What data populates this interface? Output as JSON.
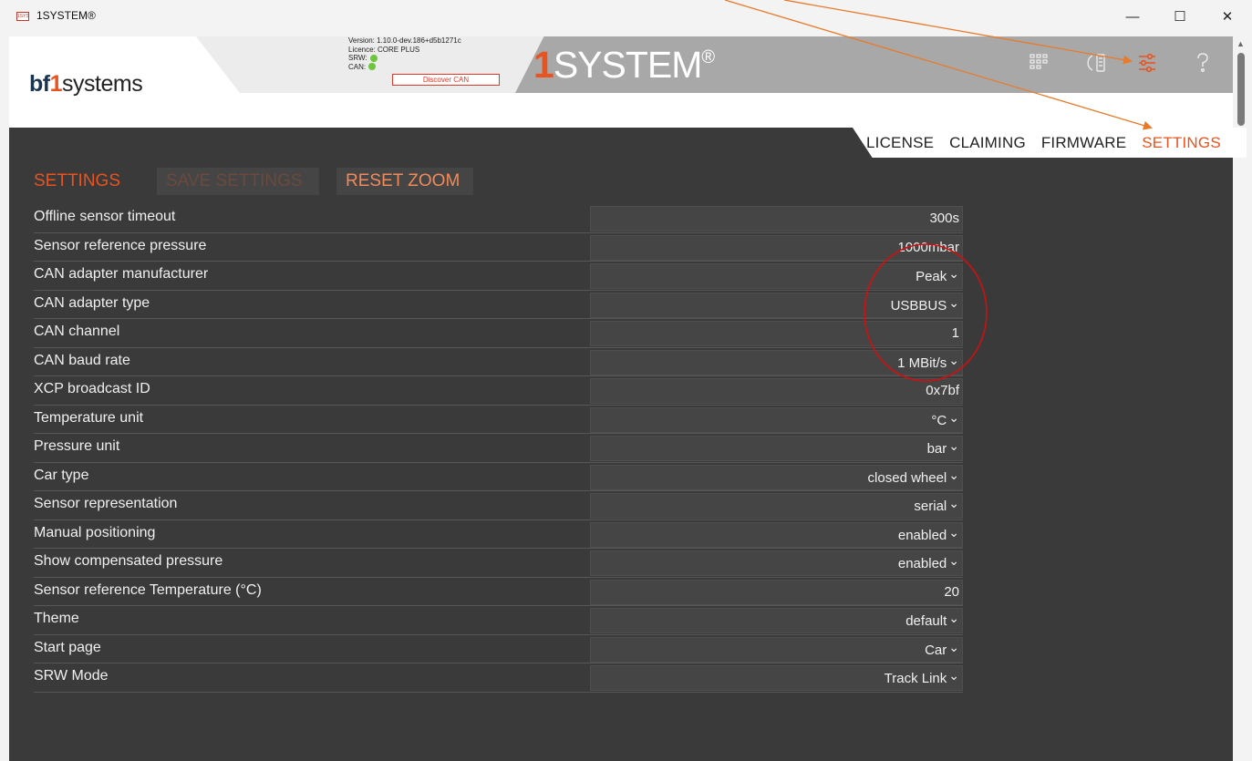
{
  "window": {
    "title": "1SYSTEM®",
    "app_icon_text": "1SYS",
    "minimize": "—",
    "maximize": "☐",
    "close": "✕"
  },
  "header": {
    "logo_bf": "bf",
    "logo_one": "1",
    "logo_rest": "systems",
    "version": "Version: 1.10.0-dev.186+d5b1271c",
    "licence": "Licence: CORE PLUS",
    "srw_label": "SRW:",
    "can_label": "CAN:",
    "discover_label": "Discover CAN",
    "brand_one": "1",
    "brand_rest": "SYSTEM",
    "brand_reg": "®"
  },
  "nav": {
    "items": [
      "LICENSE",
      "CLAIMING",
      "FIRMWARE",
      "SETTINGS"
    ],
    "active": "SETTINGS"
  },
  "toolbar": {
    "settings_label": "SETTINGS",
    "save_label": "SAVE SETTINGS",
    "reset_label": "RESET ZOOM"
  },
  "settings": [
    {
      "label": "Offline sensor timeout",
      "value": "300s",
      "dropdown": false
    },
    {
      "label": "Sensor reference pressure",
      "value": "1000mbar",
      "dropdown": false
    },
    {
      "label": "CAN adapter manufacturer",
      "value": "Peak",
      "dropdown": true
    },
    {
      "label": "CAN adapter type",
      "value": "USBBUS",
      "dropdown": true
    },
    {
      "label": "CAN channel",
      "value": "1",
      "dropdown": false
    },
    {
      "label": "CAN baud rate",
      "value": "1 MBit/s",
      "dropdown": true
    },
    {
      "label": "XCP broadcast ID",
      "value": "0x7bf",
      "dropdown": false
    },
    {
      "label": "Temperature unit",
      "value": "°C",
      "dropdown": true
    },
    {
      "label": "Pressure unit",
      "value": "bar",
      "dropdown": true
    },
    {
      "label": "Car type",
      "value": "closed wheel",
      "dropdown": true
    },
    {
      "label": "Sensor representation",
      "value": "serial",
      "dropdown": true
    },
    {
      "label": "Manual positioning",
      "value": "enabled",
      "dropdown": true
    },
    {
      "label": "Show compensated pressure",
      "value": "enabled",
      "dropdown": true
    },
    {
      "label": "Sensor reference Temperature (°C)",
      "value": "20",
      "dropdown": false
    },
    {
      "label": "Theme",
      "value": "default",
      "dropdown": true
    },
    {
      "label": "Start page",
      "value": "Car",
      "dropdown": true
    },
    {
      "label": "SRW Mode",
      "value": "Track Link",
      "dropdown": true
    }
  ],
  "colors": {
    "accent": "#e8531f",
    "panel": "#3a3a3a",
    "field": "#454545",
    "annotation_arrow": "#e87a2a",
    "annotation_circle": "#d01010"
  },
  "icons": [
    "grid-icon",
    "refresh-device-icon",
    "sliders-icon",
    "help-icon"
  ]
}
